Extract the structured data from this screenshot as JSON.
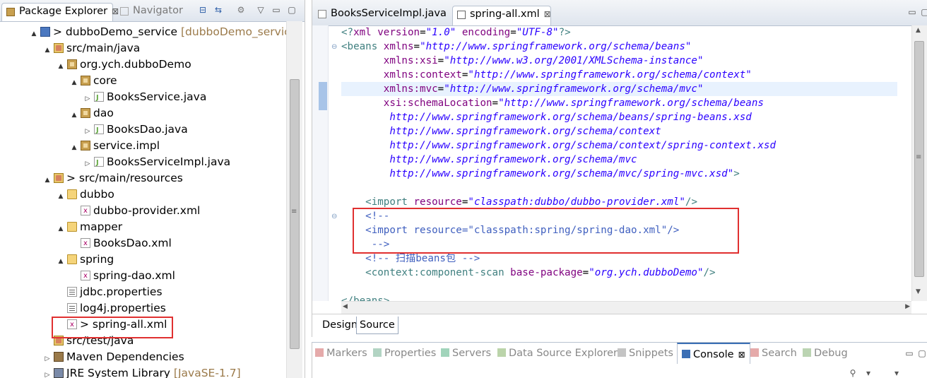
{
  "explorer": {
    "tabs": [
      {
        "label": "Package Explorer",
        "close": "⊠",
        "icon": "package-explorer-icon"
      },
      {
        "label": "Navigator",
        "icon": "navigator-icon"
      }
    ],
    "tree": [
      {
        "arrow": "▲",
        "prefix": "> ",
        "label": "dubboDemo_service",
        "suffix": " [dubboDemo_service d",
        "icon": "proj",
        "indent": 0
      },
      {
        "arrow": "▲",
        "prefix": "",
        "label": "src/main/java",
        "suffix": "",
        "icon": "srcf",
        "indent": 1
      },
      {
        "arrow": "▲",
        "prefix": "",
        "label": "org.ych.dubboDemo",
        "suffix": "",
        "icon": "pkg",
        "indent": 2
      },
      {
        "arrow": "▲",
        "prefix": "",
        "label": "core",
        "suffix": "",
        "icon": "pkg",
        "indent": 3
      },
      {
        "arrow": "▷",
        "prefix": "",
        "label": "BooksService.java",
        "suffix": "",
        "icon": "java",
        "indent": 4
      },
      {
        "arrow": "▲",
        "prefix": "",
        "label": "dao",
        "suffix": "",
        "icon": "pkg",
        "indent": 3
      },
      {
        "arrow": "▷",
        "prefix": "",
        "label": "BooksDao.java",
        "suffix": "",
        "icon": "java",
        "indent": 4
      },
      {
        "arrow": "▲",
        "prefix": "",
        "label": "service.impl",
        "suffix": "",
        "icon": "pkg",
        "indent": 3
      },
      {
        "arrow": "▷",
        "prefix": "",
        "label": "BooksServiceImpl.java",
        "suffix": "",
        "icon": "java",
        "indent": 4
      },
      {
        "arrow": "▲",
        "prefix": "> ",
        "label": "src/main/resources",
        "suffix": "",
        "icon": "srcf",
        "indent": 1
      },
      {
        "arrow": "▲",
        "prefix": "",
        "label": "dubbo",
        "suffix": "",
        "icon": "folder",
        "indent": 2
      },
      {
        "arrow": "",
        "prefix": "",
        "label": "dubbo-provider.xml",
        "suffix": "",
        "icon": "xml",
        "indent": 3
      },
      {
        "arrow": "▲",
        "prefix": "",
        "label": "mapper",
        "suffix": "",
        "icon": "folder",
        "indent": 2
      },
      {
        "arrow": "",
        "prefix": "",
        "label": "BooksDao.xml",
        "suffix": "",
        "icon": "xml",
        "indent": 3
      },
      {
        "arrow": "▲",
        "prefix": "",
        "label": "spring",
        "suffix": "",
        "icon": "folder",
        "indent": 2
      },
      {
        "arrow": "",
        "prefix": "",
        "label": "spring-dao.xml",
        "suffix": "",
        "icon": "xml",
        "indent": 3
      },
      {
        "arrow": "",
        "prefix": "",
        "label": "jdbc.properties",
        "suffix": "",
        "icon": "props",
        "indent": 2
      },
      {
        "arrow": "",
        "prefix": "",
        "label": "log4j.properties",
        "suffix": "",
        "icon": "props",
        "indent": 2
      },
      {
        "arrow": "",
        "prefix": "> ",
        "label": "spring-all.xml",
        "suffix": "",
        "icon": "xml",
        "indent": 2
      },
      {
        "arrow": "",
        "prefix": "",
        "label": "src/test/java",
        "suffix": "",
        "icon": "srcf",
        "indent": 1
      },
      {
        "arrow": "▷",
        "prefix": "",
        "label": "Maven Dependencies",
        "suffix": "",
        "icon": "jar",
        "indent": 1
      },
      {
        "arrow": "▷",
        "prefix": "",
        "label": "JRE System Library",
        "suffix": " [JavaSE-1.7]",
        "icon": "lib",
        "indent": 1
      }
    ]
  },
  "editor": {
    "tabs": [
      {
        "label": "BooksServiceImpl.java",
        "icon": "java-file-icon"
      },
      {
        "label": "spring-all.xml",
        "close": "⊠",
        "icon": "xml-file-icon"
      }
    ],
    "code_lines": [
      [
        [
          "t-pi",
          "<?"
        ],
        [
          "t-attr",
          "xml version"
        ],
        [
          "t-plain",
          "="
        ],
        [
          "t-val",
          "\"1.0\""
        ],
        [
          "t-plain",
          " "
        ],
        [
          "t-attr",
          "encoding"
        ],
        [
          "t-plain",
          "="
        ],
        [
          "t-val",
          "\"UTF-8\""
        ],
        [
          "t-pi",
          "?>"
        ]
      ],
      [
        [
          "t-tag",
          "<beans "
        ],
        [
          "t-attr",
          "xmlns"
        ],
        [
          "t-plain",
          "="
        ],
        [
          "t-val",
          "\"http://www.springframework.org/schema/beans\""
        ]
      ],
      [
        [
          "t-plain",
          "       "
        ],
        [
          "t-attr",
          "xmlns:xsi"
        ],
        [
          "t-plain",
          "="
        ],
        [
          "t-val",
          "\"http://www.w3.org/2001/XMLSchema-instance\""
        ]
      ],
      [
        [
          "t-plain",
          "       "
        ],
        [
          "t-attr",
          "xmlns:context"
        ],
        [
          "t-plain",
          "="
        ],
        [
          "t-val",
          "\"http://www.springframework.org/schema/context\""
        ]
      ],
      [
        [
          "t-plain",
          "       "
        ],
        [
          "t-attr",
          "xmlns:mvc"
        ],
        [
          "t-plain",
          "="
        ],
        [
          "t-val",
          "\"http://www.springframework.org/schema/mvc\""
        ]
      ],
      [
        [
          "t-plain",
          "       "
        ],
        [
          "t-attr",
          "xsi:schemaLocation"
        ],
        [
          "t-plain",
          "="
        ],
        [
          "t-val",
          "\"http://www.springframework.org/schema/beans"
        ]
      ],
      [
        [
          "t-val",
          "        http://www.springframework.org/schema/beans/spring-beans.xsd"
        ]
      ],
      [
        [
          "t-val",
          "        http://www.springframework.org/schema/context"
        ]
      ],
      [
        [
          "t-val",
          "        http://www.springframework.org/schema/context/spring-context.xsd"
        ]
      ],
      [
        [
          "t-val",
          "        http://www.springframework.org/schema/mvc"
        ]
      ],
      [
        [
          "t-val",
          "        http://www.springframework.org/schema/mvc/spring-mvc.xsd\""
        ],
        [
          "t-tag",
          ">"
        ]
      ],
      [
        [
          "t-plain",
          " "
        ]
      ],
      [
        [
          "t-plain",
          "    "
        ],
        [
          "t-tag",
          "<import "
        ],
        [
          "t-attr",
          "resource"
        ],
        [
          "t-plain",
          "="
        ],
        [
          "t-val",
          "\"classpath:dubbo/dubbo-provider.xml\""
        ],
        [
          "t-tag",
          "/>"
        ]
      ],
      [
        [
          "t-plain",
          "    "
        ],
        [
          "t-com",
          "<!--"
        ]
      ],
      [
        [
          "t-com",
          "    <import resource=\"classpath:spring/spring-dao.xml\"/>"
        ]
      ],
      [
        [
          "t-com",
          "     -->"
        ]
      ],
      [
        [
          "t-plain",
          "    "
        ],
        [
          "t-com",
          "<!-- 扫描beans包 -->"
        ]
      ],
      [
        [
          "t-plain",
          "    "
        ],
        [
          "t-tag",
          "<context:component-scan "
        ],
        [
          "t-attr",
          "base-package"
        ],
        [
          "t-plain",
          "="
        ],
        [
          "t-val",
          "\"org.ych.dubboDemo\""
        ],
        [
          "t-tag",
          "/>"
        ]
      ],
      [
        [
          "t-plain",
          " "
        ]
      ],
      [
        [
          "t-tag",
          "</beans>"
        ]
      ]
    ],
    "bottom_tabs": {
      "design": "Design",
      "source": "Source"
    }
  },
  "views": {
    "tabs": [
      {
        "label": "Markers",
        "icon": "markers-icon",
        "active": false
      },
      {
        "label": "Properties",
        "icon": "properties-icon",
        "active": false
      },
      {
        "label": "Servers",
        "icon": "servers-icon",
        "active": false
      },
      {
        "label": "Data Source Explorer",
        "icon": "data-source-icon",
        "active": false
      },
      {
        "label": "Snippets",
        "icon": "snippets-icon",
        "active": false
      },
      {
        "label": "Console",
        "close": "⊠",
        "icon": "console-icon",
        "active": true
      },
      {
        "label": "Search",
        "icon": "search-icon",
        "active": false
      },
      {
        "label": "Debug",
        "icon": "debug-icon",
        "active": false
      }
    ]
  }
}
